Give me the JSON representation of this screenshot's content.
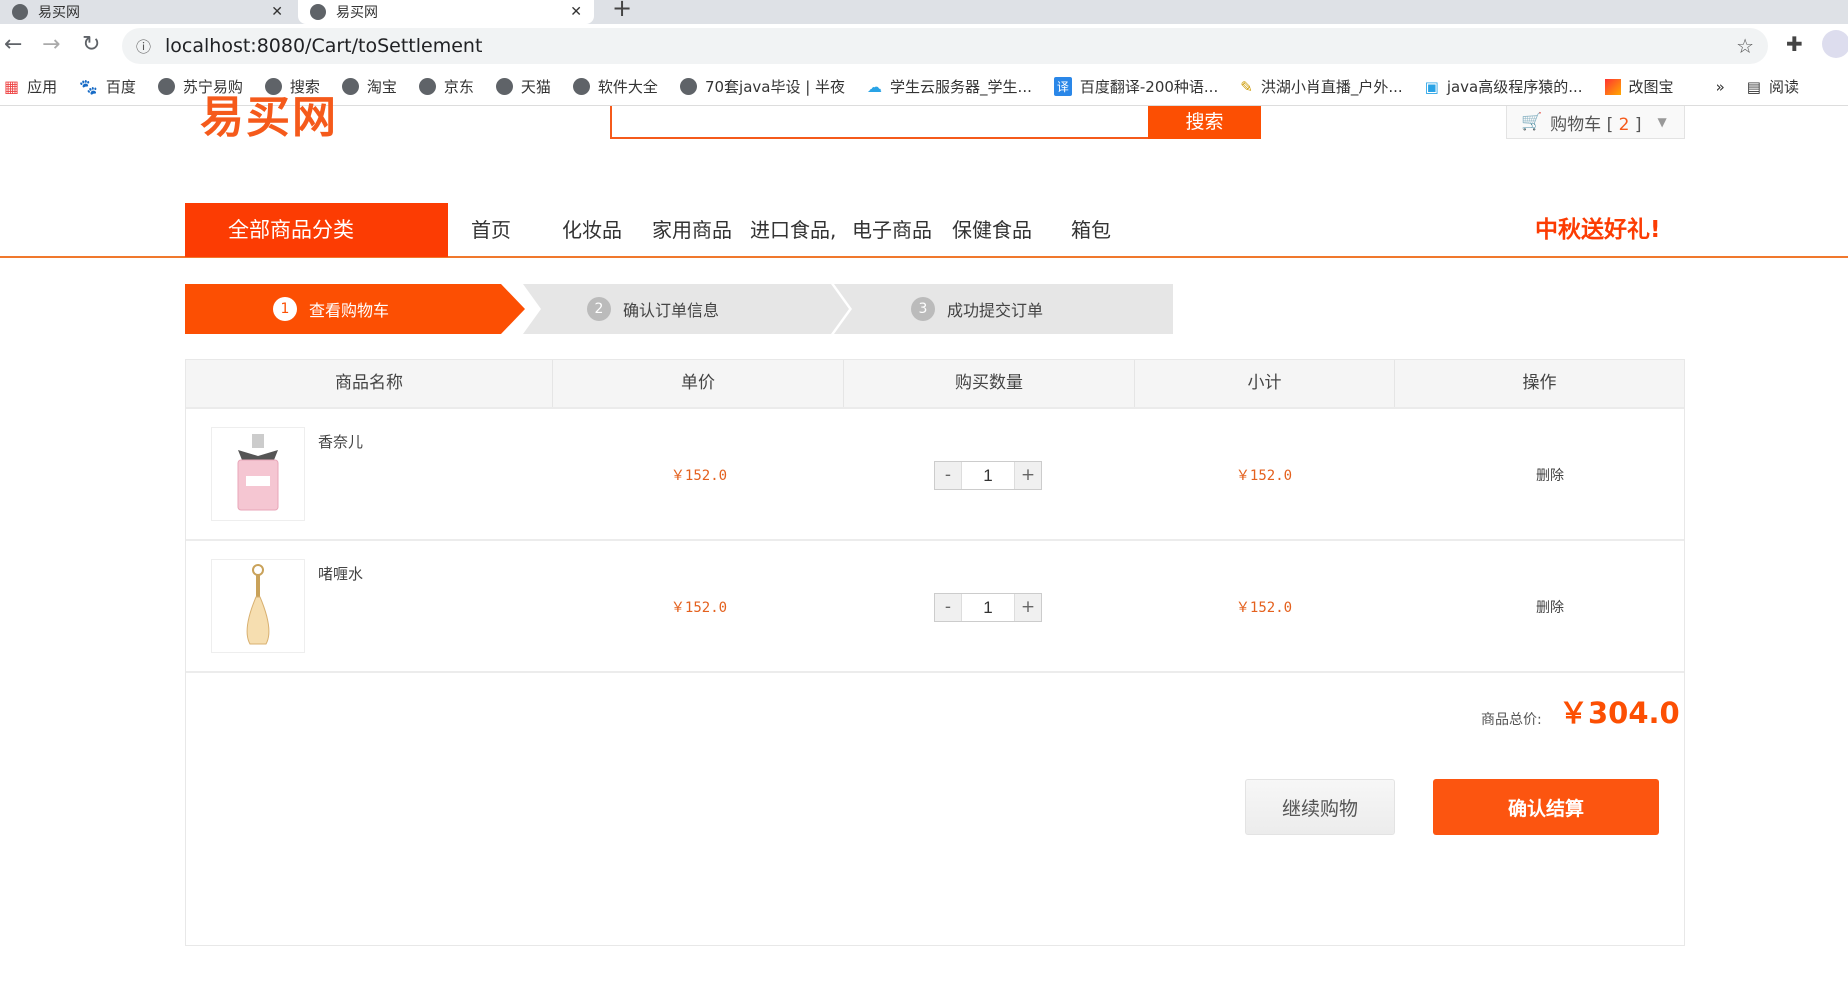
{
  "browser": {
    "tabs": [
      {
        "title": "易买网"
      },
      {
        "title": "易买网"
      }
    ],
    "url": "localhost:8080/Cart/toSettlement",
    "bookmarks": [
      "应用",
      "百度",
      "苏宁易购",
      "搜索",
      "淘宝",
      "京东",
      "天猫",
      "软件大全",
      "70套java毕设 | 半夜",
      "学生云服务器_学生...",
      "百度翻译-200种语...",
      "洪湖小肖直播_户外...",
      "java高级程序猿的...",
      "改图宝"
    ],
    "reading_list": "阅读"
  },
  "header": {
    "logo": "易买网",
    "search_button": "搜索",
    "search_value": "",
    "cart_label": "购物车 [",
    "cart_count": "2",
    "cart_close": "]"
  },
  "nav": {
    "all_categories": "全部商品分类",
    "items": [
      "首页",
      "化妆品",
      "家用商品",
      "进口食品,",
      "电子商品",
      "保健食品",
      "箱包"
    ],
    "promo": "中秋送好礼!"
  },
  "steps": [
    {
      "num": "1",
      "label": "查看购物车",
      "active": true
    },
    {
      "num": "2",
      "label": "确认订单信息",
      "active": false
    },
    {
      "num": "3",
      "label": "成功提交订单",
      "active": false
    }
  ],
  "table": {
    "headers": [
      "商品名称",
      "单价",
      "购买数量",
      "小计",
      "操作"
    ],
    "rows": [
      {
        "name": "香奈儿",
        "price": "￥152.0",
        "qty": "1",
        "subtotal": "￥152.0",
        "action": "删除",
        "image": "pink-perfume"
      },
      {
        "name": "啫喱水",
        "price": "￥152.0",
        "qty": "1",
        "subtotal": "￥152.0",
        "action": "删除",
        "image": "gold-perfume"
      }
    ],
    "minus": "-",
    "plus": "+"
  },
  "summary": {
    "total_label": "商品总价:",
    "total_value": "￥304.0",
    "continue_button": "继续购物",
    "checkout_button": "确认结算"
  },
  "colors": {
    "accent": "#fc4f03",
    "price": "#e4611e"
  }
}
